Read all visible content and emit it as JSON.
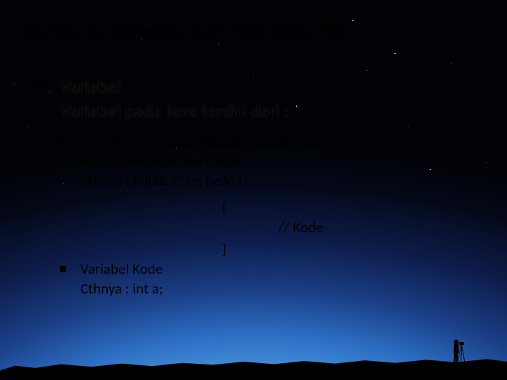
{
  "title": "Keyword, Variabel, dan Tipe Data (3)",
  "main_bullet": {
    "heading": "Variabel",
    "desc": "Variabel pada Java terdiri dari :"
  },
  "sub_bullets": [
    {
      "line1": "Variabel Class yang dikenal sebagai property yang",
      "line2": "merupakan state dari objek",
      "line3": "Cthnya : Public Class hello ()"
    },
    {
      "line1": "Variabel Kode",
      "line2": "Cthnya : int a;"
    }
  ],
  "code": {
    "open": "{",
    "comment": "// Kode",
    "close": "}"
  },
  "bullets": {
    "diamond": "❖",
    "square": ""
  }
}
